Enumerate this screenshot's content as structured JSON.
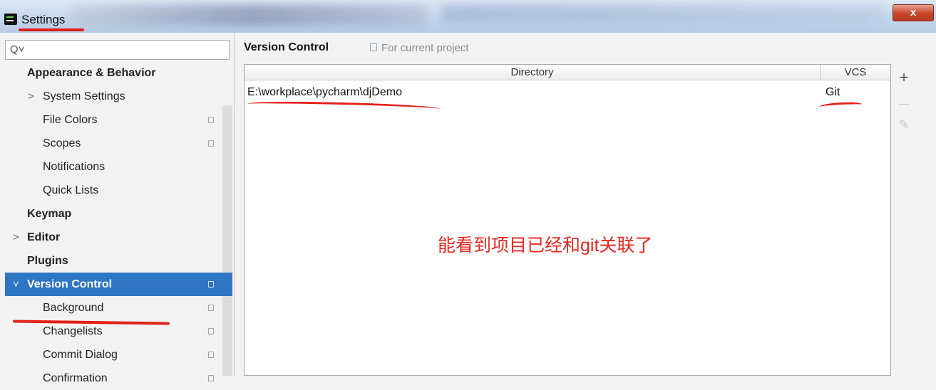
{
  "window": {
    "title": "Settings",
    "close_label": "x"
  },
  "search": {
    "placeholder": "Q˅"
  },
  "tree": [
    {
      "label": "Appearance & Behavior",
      "bold": true,
      "level": 0,
      "arrow": "",
      "project_icon": false
    },
    {
      "label": "System Settings",
      "bold": false,
      "level": 1,
      "arrow": ">",
      "project_icon": false
    },
    {
      "label": "File Colors",
      "bold": false,
      "level": 2,
      "arrow": "",
      "project_icon": true
    },
    {
      "label": "Scopes",
      "bold": false,
      "level": 2,
      "arrow": "",
      "project_icon": true
    },
    {
      "label": "Notifications",
      "bold": false,
      "level": 2,
      "arrow": "",
      "project_icon": false
    },
    {
      "label": "Quick Lists",
      "bold": false,
      "level": 2,
      "arrow": "",
      "project_icon": false
    },
    {
      "label": "Keymap",
      "bold": true,
      "level": 0,
      "arrow": "",
      "project_icon": false
    },
    {
      "label": "Editor",
      "bold": true,
      "level": 0,
      "arrow": ">",
      "project_icon": false
    },
    {
      "label": "Plugins",
      "bold": true,
      "level": 0,
      "arrow": "",
      "project_icon": false
    },
    {
      "label": "Version Control",
      "bold": true,
      "level": 0,
      "arrow": "˅",
      "project_icon": true,
      "selected": true
    },
    {
      "label": "Background",
      "bold": false,
      "level": 2,
      "arrow": "",
      "project_icon": true
    },
    {
      "label": "Changelists",
      "bold": false,
      "level": 2,
      "arrow": "",
      "project_icon": true
    },
    {
      "label": "Commit Dialog",
      "bold": false,
      "level": 2,
      "arrow": "",
      "project_icon": true
    },
    {
      "label": "Confirmation",
      "bold": false,
      "level": 2,
      "arrow": "",
      "project_icon": true
    }
  ],
  "panel": {
    "title": "Version Control",
    "scope_label": "For current project"
  },
  "table": {
    "headers": {
      "directory": "Directory",
      "vcs": "VCS"
    },
    "rows": [
      {
        "directory": "E:\\workplace\\pycharm\\djDemo",
        "vcs": "Git"
      }
    ]
  },
  "toolbar": {
    "add": "+",
    "remove": "—",
    "edit": "✎"
  },
  "annotation": "能看到项目已经和git关联了",
  "colors": {
    "selection": "#2e76c4",
    "annotation_red": "#e8271f"
  }
}
